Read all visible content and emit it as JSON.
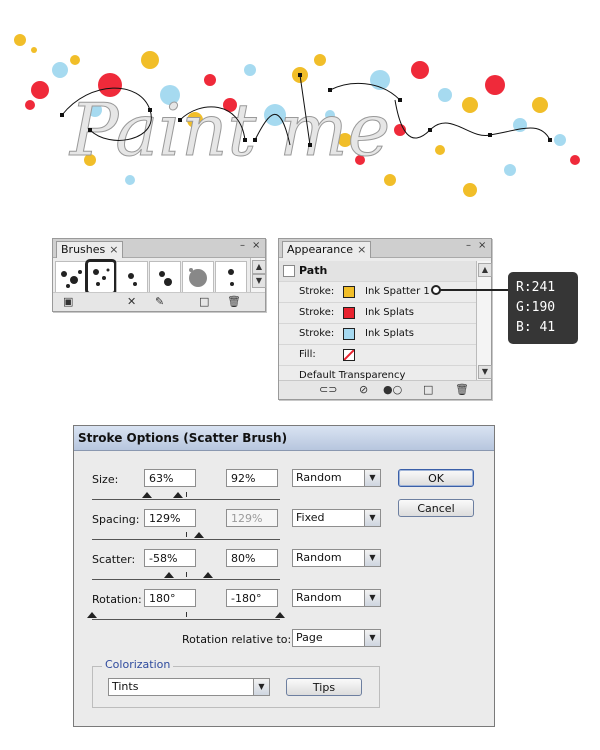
{
  "artwork": {
    "title_text": "Paint me",
    "splatter_colors": {
      "red": "#ef2a3a",
      "yellow": "#f1be29",
      "blue": "#a6daf0"
    }
  },
  "brushes_panel": {
    "tab_label": "Brushes",
    "close_glyph": "×",
    "window_minimize": "–",
    "window_close": "×"
  },
  "appearance_panel": {
    "tab_label": "Appearance",
    "close_glyph": "×",
    "object": "Path",
    "rows": [
      {
        "label": "Stroke:",
        "swatch": "#f1be29",
        "name": "Ink Spatter 1"
      },
      {
        "label": "Stroke:",
        "swatch": "#e8232f",
        "name": "Ink Splats"
      },
      {
        "label": "Stroke:",
        "swatch": "#a6d9f0",
        "name": "Ink Splats"
      },
      {
        "label": "Fill:",
        "swatch": "none",
        "name": ""
      }
    ],
    "footer": "Default Transparency"
  },
  "color_readout": {
    "r": "R:241",
    "g": "G:190",
    "b": "B: 41"
  },
  "dialog": {
    "title": "Stroke Options (Scatter Brush)",
    "size": {
      "label": "Size:",
      "min": "63%",
      "max": "92%",
      "mode": "Random"
    },
    "spacing": {
      "label": "Spacing:",
      "min": "129%",
      "max": "129%",
      "mode": "Fixed"
    },
    "scatter": {
      "label": "Scatter:",
      "min": "-58%",
      "max": "80%",
      "mode": "Random"
    },
    "rotation": {
      "label": "Rotation:",
      "min": "180°",
      "max": "-180°",
      "mode": "Random"
    },
    "rotation_relative_label": "Rotation relative to:",
    "rotation_relative_value": "Page",
    "colorization_label": "Colorization",
    "colorization_method": "Tints",
    "ok": "OK",
    "cancel": "Cancel",
    "tips": "Tips"
  }
}
